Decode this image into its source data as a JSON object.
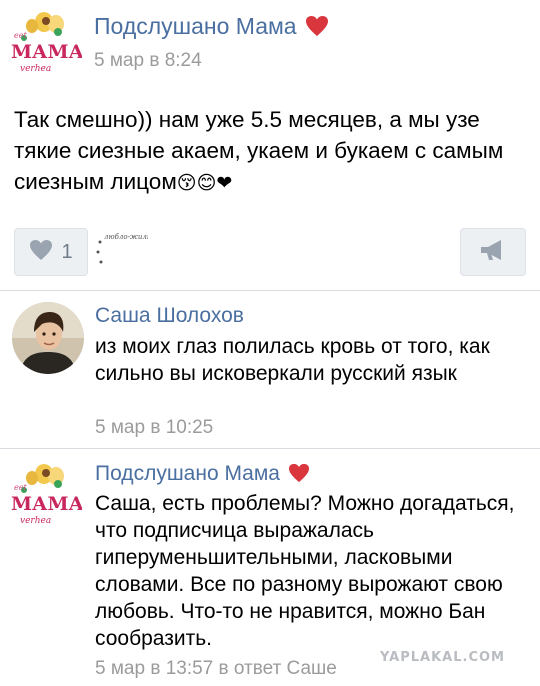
{
  "post": {
    "author": "Подслушано Мама",
    "time": "5 мар в 8:24",
    "text": "Так смешно)) нам уже 5.5 месяцев, а мы узе тякие сиезные акаем, укаем и букаем с самым сиезным лицом",
    "emoji_suffix": "😚😊❤",
    "like_count": "1",
    "liker_avatar_caption": "любло-жилюбку"
  },
  "comments": [
    {
      "author": "Саша Шолохов",
      "text": "из моих глаз полилась кровь от того, как сильно вы исковеркали русский язык",
      "time": "5 мар в 10:25"
    },
    {
      "author": "Подслушано Мама",
      "text": "Саша, есть проблемы? Можно догадаться, что подписчица выражалась гиперуменьшительными, ласковыми словами. Все по разному вырожают свою любовь. Что-то не нравится, можно Бан сообразить.",
      "time": "5 мар в 13:57",
      "reply_to": "в ответ Саше"
    }
  ],
  "logo": {
    "line1": "eet",
    "line2": "МАМА",
    "line3": "verhea"
  },
  "icons": {
    "heart_badge": "heart-badge-icon",
    "like": "heart-icon",
    "share": "megaphone-icon"
  },
  "colors": {
    "author_blue": "#4a6fa0",
    "meta_gray": "#9b9b9b",
    "heart_red": "#d9363e",
    "button_bg": "#edf0f3"
  },
  "watermark": "YAPLAKAL.COM"
}
